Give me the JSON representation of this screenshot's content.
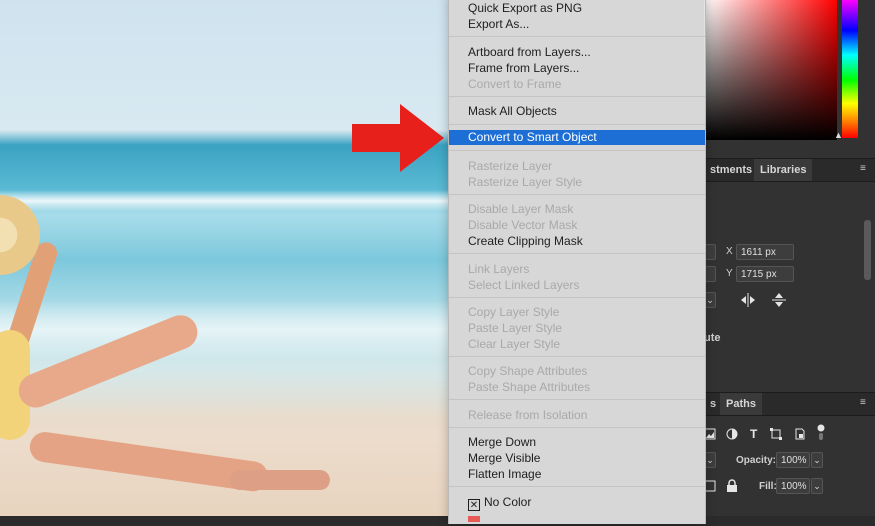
{
  "menu": {
    "items": [
      {
        "label": "Quick Export as PNG",
        "state": "enabled"
      },
      {
        "label": "Export As...",
        "state": "enabled"
      },
      {
        "label": "Artboard from Layers...",
        "state": "enabled"
      },
      {
        "label": "Frame from Layers...",
        "state": "enabled"
      },
      {
        "label": "Convert to Frame",
        "state": "disabled"
      },
      {
        "label": "Mask All Objects",
        "state": "enabled"
      },
      {
        "label": "Convert to Smart Object",
        "state": "selected"
      },
      {
        "label": "Rasterize Layer",
        "state": "disabled"
      },
      {
        "label": "Rasterize Layer Style",
        "state": "disabled"
      },
      {
        "label": "Disable Layer Mask",
        "state": "disabled"
      },
      {
        "label": "Disable Vector Mask",
        "state": "disabled"
      },
      {
        "label": "Create Clipping Mask",
        "state": "enabled"
      },
      {
        "label": "Link Layers",
        "state": "disabled"
      },
      {
        "label": "Select Linked Layers",
        "state": "disabled"
      },
      {
        "label": "Copy Layer Style",
        "state": "disabled"
      },
      {
        "label": "Paste Layer Style",
        "state": "disabled"
      },
      {
        "label": "Clear Layer Style",
        "state": "disabled"
      },
      {
        "label": "Copy Shape Attributes",
        "state": "disabled"
      },
      {
        "label": "Paste Shape Attributes",
        "state": "disabled"
      },
      {
        "label": "Release from Isolation",
        "state": "disabled"
      },
      {
        "label": "Merge Down",
        "state": "enabled"
      },
      {
        "label": "Merge Visible",
        "state": "enabled"
      },
      {
        "label": "Flatten Image",
        "state": "enabled"
      },
      {
        "label": "No Color",
        "state": "enabled"
      }
    ],
    "check_glyph": "✕"
  },
  "panels": {
    "tab_adjustments": "stments",
    "tab_libraries": "Libraries",
    "x_label": "X",
    "x_value": "1611 px",
    "y_label": "Y",
    "y_value": "1715 px",
    "attribute_partial": "ute",
    "tab_paths": "Paths",
    "opacity_label": "Opacity:",
    "opacity_value": "100%",
    "fill_label": "Fill:",
    "fill_value": "100%"
  },
  "colors": {
    "selection": "#1d6fd6",
    "arrow": "#e8201c",
    "menu_bg": "#e2e2e2",
    "panel_bg": "#323232"
  },
  "icons": [
    "red-arrow-icon",
    "flip-horizontal-icon",
    "flip-vertical-icon",
    "image-filter-icon",
    "adjustment-filter-icon",
    "type-filter-icon",
    "shape-filter-icon",
    "smart-object-filter-icon",
    "filter-toggle-icon",
    "lock-icon",
    "menu-icon"
  ]
}
